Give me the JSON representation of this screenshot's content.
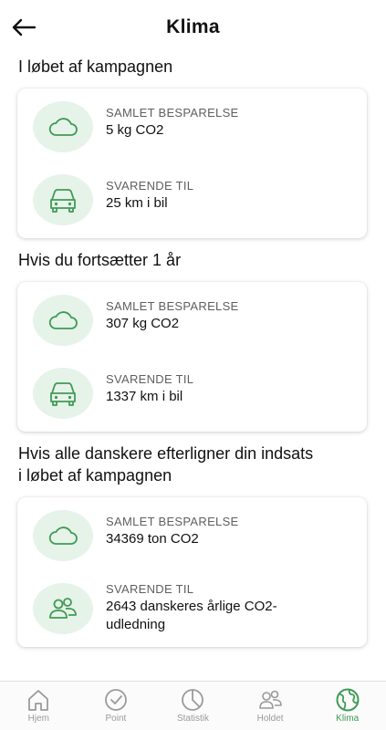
{
  "header": {
    "title": "Klima",
    "back_icon": "arrow-left-icon"
  },
  "sections": [
    {
      "heading": "I løbet af kampagnen",
      "rows": [
        {
          "icon": "cloud-icon",
          "label": "SAMLET BESPARELSE",
          "value": "5 kg CO2"
        },
        {
          "icon": "car-icon",
          "label": "SVARENDE TIL",
          "value": "25 km i bil"
        }
      ]
    },
    {
      "heading": "Hvis du fortsætter 1 år",
      "rows": [
        {
          "icon": "cloud-icon",
          "label": "SAMLET BESPARELSE",
          "value": "307 kg CO2"
        },
        {
          "icon": "car-icon",
          "label": "SVARENDE TIL",
          "value": "1337 km i bil"
        }
      ]
    },
    {
      "heading": "Hvis alle danskere efterligner din indsats i løbet af kampagnen",
      "rows": [
        {
          "icon": "cloud-icon",
          "label": "SAMLET BESPARELSE",
          "value": "34369 ton CO2"
        },
        {
          "icon": "people-icon",
          "label": "SVARENDE TIL",
          "value": "2643 danskeres årlige CO2-udledning"
        }
      ]
    }
  ],
  "nav": [
    {
      "label": "Hjem",
      "icon": "home-icon"
    },
    {
      "label": "Point",
      "icon": "check-circle-icon"
    },
    {
      "label": "Statistik",
      "icon": "pie-chart-icon"
    },
    {
      "label": "Holdet",
      "icon": "team-icon"
    },
    {
      "label": "Klima",
      "icon": "globe-icon"
    }
  ],
  "colors": {
    "accent": "#3f9b55",
    "icon_bg": "#e6f3e9",
    "nav_inactive": "#9a9a9a"
  }
}
